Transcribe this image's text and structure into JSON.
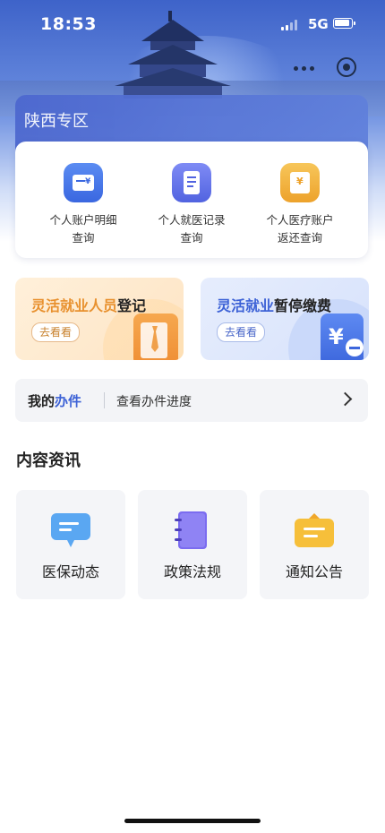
{
  "status_bar": {
    "time": "18:53",
    "network": "5G"
  },
  "zone": {
    "title": "陕西专区",
    "services": [
      {
        "label": "个人账户明细\n查询",
        "icon": "card-yen-icon",
        "line1": "个人账户明细",
        "line2": "查询"
      },
      {
        "label": "个人就医记录查询",
        "icon": "document-icon",
        "line1": "个人就医记录",
        "line2": "查询"
      },
      {
        "label": "个人医疗账户返还查询",
        "icon": "yen-receipt-icon",
        "line1": "个人医疗账户",
        "line2": "返还查询"
      }
    ]
  },
  "promos": [
    {
      "title_a": "灵活就业人员",
      "title_b": "登记",
      "button": "去看看",
      "icon": "tie-icon"
    },
    {
      "title_a": "灵活就业",
      "title_b": "暂停缴费",
      "button": "去看看",
      "icon": "yen-minus-icon"
    }
  ],
  "progress": {
    "mine_a": "我的",
    "mine_b": "办件",
    "desc": "查看办件进度"
  },
  "content": {
    "title": "内容资讯",
    "items": [
      {
        "label": "医保动态",
        "icon": "message-icon"
      },
      {
        "label": "政策法规",
        "icon": "notebook-icon"
      },
      {
        "label": "通知公告",
        "icon": "notice-icon"
      }
    ]
  },
  "colors": {
    "brand_blue": "#3d62d6",
    "accent_orange": "#e8912f"
  }
}
